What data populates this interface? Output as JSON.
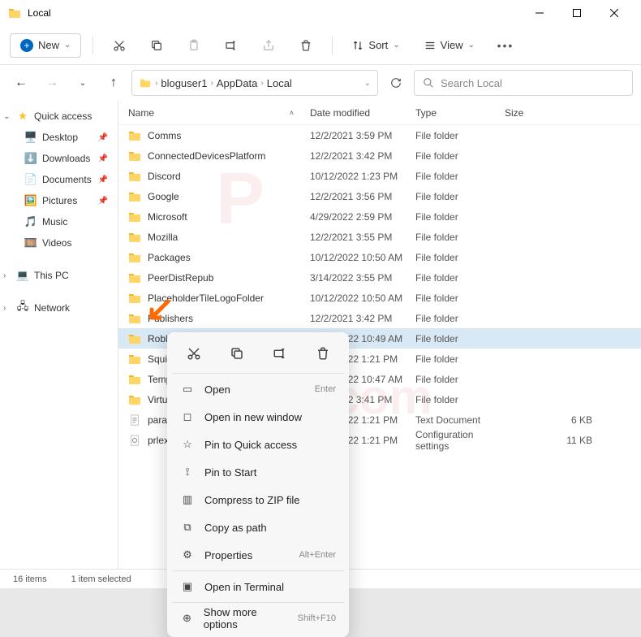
{
  "title": "Local",
  "toolbar": {
    "new": "New",
    "sort": "Sort",
    "view": "View"
  },
  "breadcrumb": [
    "bloguser1",
    "AppData",
    "Local"
  ],
  "search_placeholder": "Search Local",
  "columns": {
    "name": "Name",
    "date": "Date modified",
    "type": "Type",
    "size": "Size"
  },
  "sidebar": {
    "quick": "Quick access",
    "items": [
      {
        "icon": "🖥️",
        "label": "Desktop",
        "pin": true
      },
      {
        "icon": "⬇️",
        "label": "Downloads",
        "pin": true
      },
      {
        "icon": "📄",
        "label": "Documents",
        "pin": true
      },
      {
        "icon": "🖼️",
        "label": "Pictures",
        "pin": true
      },
      {
        "icon": "🎵",
        "label": "Music",
        "pin": false
      },
      {
        "icon": "🎞️",
        "label": "Videos",
        "pin": false
      }
    ],
    "thispc": "This PC",
    "network": "Network"
  },
  "rows": [
    {
      "name": "Comms",
      "date": "12/2/2021 3:59 PM",
      "type": "File folder",
      "size": "",
      "kind": "folder"
    },
    {
      "name": "ConnectedDevicesPlatform",
      "date": "12/2/2021 3:42 PM",
      "type": "File folder",
      "size": "",
      "kind": "folder"
    },
    {
      "name": "Discord",
      "date": "10/12/2022 1:23 PM",
      "type": "File folder",
      "size": "",
      "kind": "folder"
    },
    {
      "name": "Google",
      "date": "12/2/2021 3:56 PM",
      "type": "File folder",
      "size": "",
      "kind": "folder"
    },
    {
      "name": "Microsoft",
      "date": "4/29/2022 2:59 PM",
      "type": "File folder",
      "size": "",
      "kind": "folder"
    },
    {
      "name": "Mozilla",
      "date": "12/2/2021 3:55 PM",
      "type": "File folder",
      "size": "",
      "kind": "folder"
    },
    {
      "name": "Packages",
      "date": "10/12/2022 10:50 AM",
      "type": "File folder",
      "size": "",
      "kind": "folder"
    },
    {
      "name": "PeerDistRepub",
      "date": "3/14/2022 3:55 PM",
      "type": "File folder",
      "size": "",
      "kind": "folder"
    },
    {
      "name": "PlaceholderTileLogoFolder",
      "date": "10/12/2022 10:50 AM",
      "type": "File folder",
      "size": "",
      "kind": "folder"
    },
    {
      "name": "Publishers",
      "date": "12/2/2021 3:42 PM",
      "type": "File folder",
      "size": "",
      "kind": "folder"
    },
    {
      "name": "Roblox",
      "date": "10/12/2022 10:49 AM",
      "type": "File folder",
      "size": "",
      "kind": "folder",
      "selected": true
    },
    {
      "name": "SquirrelTemp",
      "date": "10/12/2022 1:21 PM",
      "type": "File folder",
      "size": "",
      "kind": "folder"
    },
    {
      "name": "Temp",
      "date": "10/12/2022 10:47 AM",
      "type": "File folder",
      "size": "",
      "kind": "folder"
    },
    {
      "name": "VirtualStore",
      "date": "4/21/2022 3:41 PM",
      "type": "File folder",
      "size": "",
      "kind": "folder"
    },
    {
      "name": "parallels-tools",
      "date": "10/12/2022 1:21 PM",
      "type": "Text Document",
      "size": "6 KB",
      "kind": "txt"
    },
    {
      "name": "prlextscript",
      "date": "10/12/2022 1:21 PM",
      "type": "Configuration settings",
      "size": "11 KB",
      "kind": "ini"
    }
  ],
  "ctx": {
    "open": "Open",
    "open_sc": "Enter",
    "open_new": "Open in new window",
    "pin_qa": "Pin to Quick access",
    "pin_start": "Pin to Start",
    "zip": "Compress to ZIP file",
    "copy_path": "Copy as path",
    "props": "Properties",
    "props_sc": "Alt+Enter",
    "terminal": "Open in Terminal",
    "more": "Show more options",
    "more_sc": "Shift+F10"
  },
  "status": {
    "count": "16 items",
    "sel": "1 item selected"
  },
  "watermark": "pcrisk.com"
}
